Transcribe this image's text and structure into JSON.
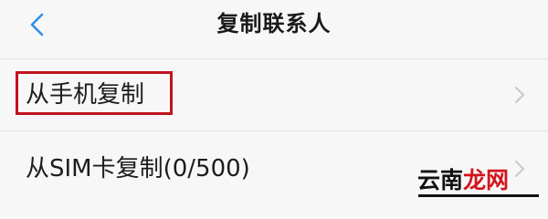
{
  "header": {
    "title": "复制联系人",
    "back_icon": "chevron-left-icon"
  },
  "options": [
    {
      "label": "从手机复制",
      "icon": "chevron-right-icon"
    },
    {
      "label": "从SIM卡复制(0/500)",
      "icon": "chevron-right-icon"
    }
  ],
  "watermark": {
    "part1": "云南",
    "part2": "龙网"
  },
  "colors": {
    "background": "#f7f7f7",
    "accent_blue": "#2f8fe6",
    "highlight_red": "#c0131e",
    "divider": "#e2e2e2",
    "watermark_red": "#d4141c"
  }
}
